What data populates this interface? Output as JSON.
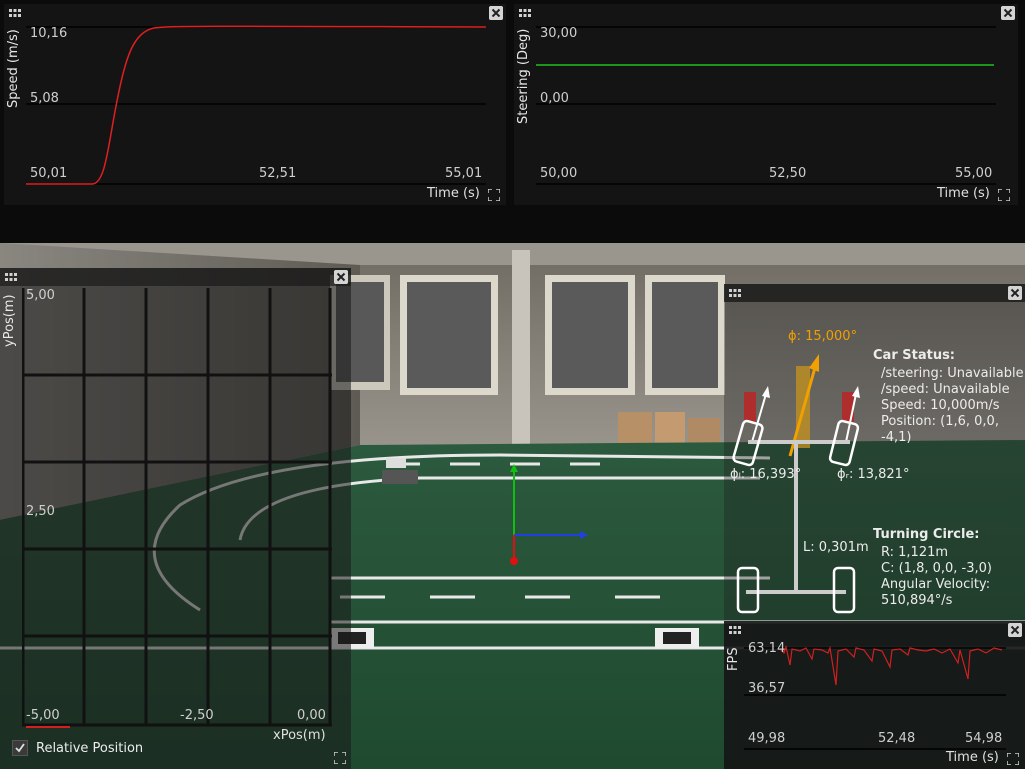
{
  "speed_chart": {
    "ylabel": "Speed (m/s)",
    "xlabel": "Time (s)",
    "yticks": [
      "10,16",
      "5,08",
      "50,01"
    ],
    "xticks": [
      "52,51",
      "55,01"
    ],
    "line_color": "#e02020"
  },
  "steering_chart": {
    "ylabel": "Steering (Deg)",
    "xlabel": "Time (s)",
    "yticks": [
      "30,00",
      "0,00"
    ],
    "xticks": [
      "50,00",
      "52,50",
      "55,00"
    ],
    "line_color": "#20c020"
  },
  "position_chart": {
    "ylabel": "yPos(m)",
    "xlabel": "xPos(m)",
    "yticks": [
      "5,00",
      "2,50"
    ],
    "xticks": [
      "-5,00",
      "-2,50",
      "0,00"
    ],
    "checkbox_label": "Relative Position",
    "checkbox_checked": true
  },
  "car_status": {
    "phi_label": "ϕ: 15,000°",
    "phi_left": "ϕₗ: 16,393°",
    "phi_right": "ϕᵣ: 13,821°",
    "length_label": "L: 0,301m",
    "title": "Car Status:",
    "steering": "/steering: Unavailable",
    "speed_topic": "/speed: Unavailable",
    "speed": "Speed: 10,000m/s",
    "position_a": "Position: (1,6, 0,0,",
    "position_b": "-4,1)",
    "turning_title": "Turning Circle:",
    "radius": "R: 1,121m",
    "center": "C: (1,8, 0,0, -3,0)",
    "angular_a": "Angular Velocity:",
    "angular_b": "510,894°/s",
    "accent_color": "#f0a000"
  },
  "fps_chart": {
    "ylabel": "FPS",
    "xlabel": "Time (s)",
    "yticks": [
      "63,14",
      "36,57"
    ],
    "xticks": [
      "49,98",
      "52,48",
      "54,98"
    ],
    "line_color": "#d02020"
  }
}
